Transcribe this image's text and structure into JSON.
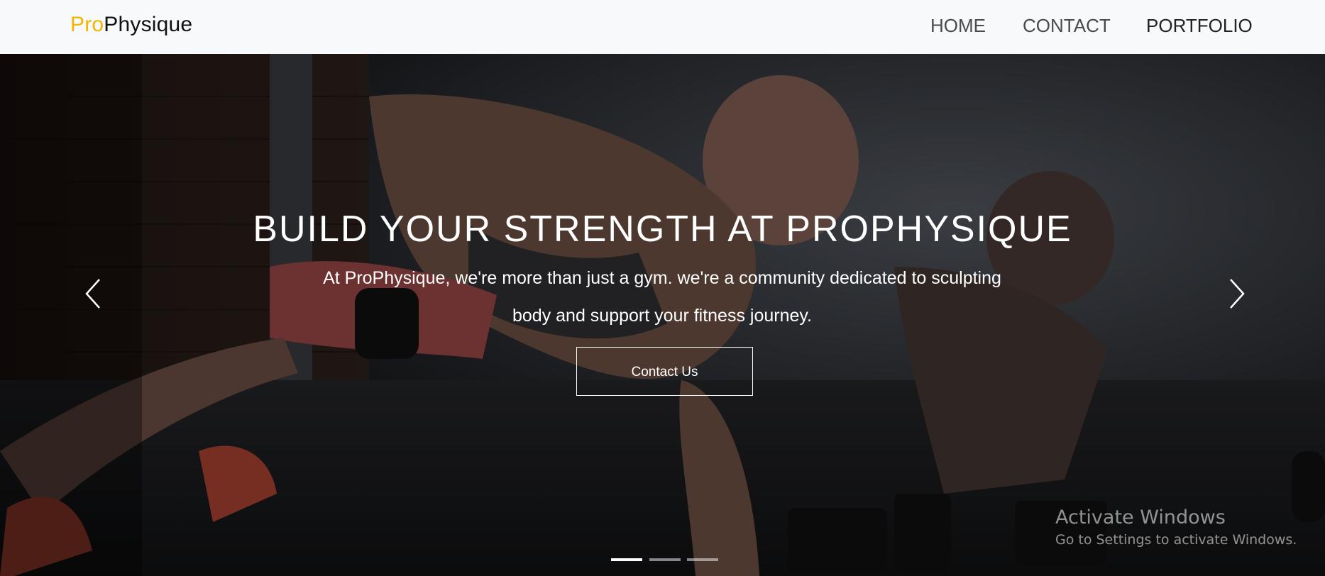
{
  "navbar": {
    "brand": {
      "accent": "Pro",
      "rest": "Physique"
    },
    "links": [
      {
        "label": "HOME"
      },
      {
        "label": "CONTACT"
      },
      {
        "label": "PORTFOLIO"
      }
    ]
  },
  "hero": {
    "title": "BUILD YOUR STRENGTH AT PROPHYSIQUE",
    "description": "At ProPhysique, we're more than just a gym. we're a community dedicated to sculpting body and support your fitness journey.",
    "cta_label": "Contact Us",
    "prev_icon": "chevron-left-icon",
    "next_icon": "chevron-right-icon",
    "slides_total": 3,
    "active_slide": 1
  },
  "watermark": {
    "title": "Activate Windows",
    "subtitle": "Go to Settings to activate Windows."
  },
  "colors": {
    "accent": "#f4b400",
    "navbar_bg": "#f8f9fa",
    "hero_text": "#ffffff"
  }
}
